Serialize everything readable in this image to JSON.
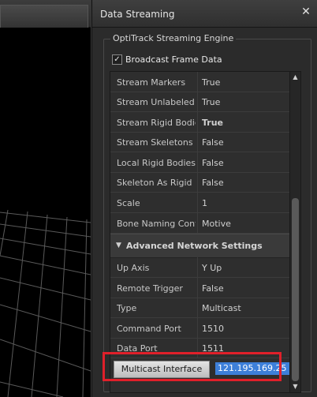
{
  "panel": {
    "title": "Data Streaming",
    "close_glyph": "✕"
  },
  "group": {
    "title": "OptiTrack Streaming Engine",
    "broadcast_label": "Broadcast Frame Data",
    "broadcast_checked": true
  },
  "properties": [
    {
      "name": "Stream Markers",
      "value": "True"
    },
    {
      "name": "Stream Unlabeled Ma",
      "value": "True"
    },
    {
      "name": "Stream Rigid Bodies",
      "value": "True"
    },
    {
      "name": "Stream Skeletons",
      "value": "False"
    },
    {
      "name": "Local Rigid Bodies",
      "value": "False"
    },
    {
      "name": "Skeleton As Rigid Boc",
      "value": "False"
    },
    {
      "name": "Scale",
      "value": "1"
    },
    {
      "name": "Bone Naming Conven",
      "value": "Motive"
    }
  ],
  "section": {
    "label": "Advanced Network Settings"
  },
  "advanced": [
    {
      "name": "Up Axis",
      "value": "Y Up"
    },
    {
      "name": "Remote Trigger",
      "value": "False"
    },
    {
      "name": "Type",
      "value": "Multicast"
    },
    {
      "name": "Command Port",
      "value": "1510"
    },
    {
      "name": "Data Port",
      "value": "1511"
    }
  ],
  "multicast": {
    "name": "Multicast Interface",
    "value": "121.195.169.25"
  },
  "colors": {
    "highlight": "#e0202a",
    "selection": "#3d7fd9"
  },
  "icons": {
    "close": "close-icon",
    "scroll_up": "chevron-up-icon",
    "scroll_down": "chevron-down-icon",
    "collapse": "triangle-down-icon"
  }
}
